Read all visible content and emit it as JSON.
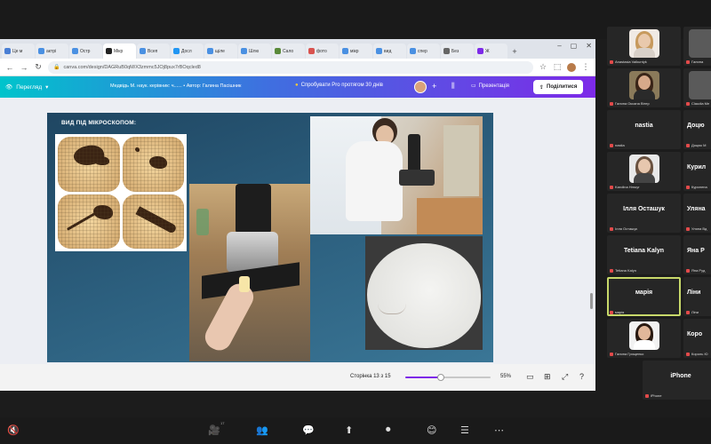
{
  "browser": {
    "tabs": [
      {
        "label": "Це м",
        "color": "#4a7fd4"
      },
      {
        "label": "актрі",
        "color": "#4a90e2"
      },
      {
        "label": "Остр",
        "color": "#4a90e2"
      },
      {
        "label": "Мікр",
        "color": "#222222"
      },
      {
        "label": "Всеп",
        "color": "#4a90e2"
      },
      {
        "label": "Досл",
        "color": "#2196f3"
      },
      {
        "label": "щіле",
        "color": "#4a90e2"
      },
      {
        "label": "Шлю",
        "color": "#4a90e2"
      },
      {
        "label": "Сало",
        "color": "#5a8a3a"
      },
      {
        "label": "фото",
        "color": "#d9534f"
      },
      {
        "label": "мікр",
        "color": "#4a90e2"
      },
      {
        "label": "вид",
        "color": "#4a90e2"
      },
      {
        "label": "спер",
        "color": "#4a90e2"
      },
      {
        "label": "Без",
        "color": "#666666"
      },
      {
        "label": "Ж",
        "color": "#7d2ae8"
      }
    ],
    "add_tab": "+",
    "url": "canva.com/design/DAGRuB0qM/X3zmmc5JOj8pux7rBOqcled8",
    "window_controls": [
      "–",
      "▢",
      "✕"
    ]
  },
  "canva": {
    "view_label": "Перегляд",
    "design_title": "Медвідь М. наук. керівник: ч...... • Автор: Галина Пасішник",
    "pro_label": "Спробувати Pro протягом 30 днів",
    "present_label": "Презентація",
    "share_label": "Поділитися",
    "slide": {
      "title": "ВИД ПІД МІКРОСКОПОМ:"
    },
    "page_indicator": "Сторінка 13 з 15",
    "zoom_value": "55%",
    "zoom_level": 0.42
  },
  "participants": {
    "col1": [
      {
        "name": "",
        "caption": "Anastasia Valkuntyk",
        "video": true,
        "skin": "#e9c9ac",
        "hair": "#c79a5d",
        "bg": "#f0eae4",
        "shirt": "#d8d0c8"
      },
      {
        "name": "",
        "caption": "Галина Оксана Вітер",
        "video": true,
        "skin": "#d7a98a",
        "hair": "#3a2518",
        "bg": "#8a7a5a",
        "shirt": "#2a2a2a"
      },
      {
        "name": "nastia",
        "caption": "nastia",
        "video": false
      },
      {
        "name": "",
        "caption": "Karolina Hmuyr",
        "video": true,
        "skin": "#e7c7ae",
        "hair": "#6a5240",
        "bg": "#e8e8e8",
        "shirt": "#444444"
      },
      {
        "name": "Ілля Осташук",
        "caption": "Ілля Осташук",
        "video": false
      },
      {
        "name": "Tetiana Kalyn",
        "caption": "Tetiana Kalyn",
        "video": false
      },
      {
        "name": "марія",
        "caption": "марія",
        "video": false,
        "highlight": true
      },
      {
        "name": "",
        "caption": "Галина Грищенко",
        "video": true,
        "skin": "#e1b79a",
        "hair": "#2a1a12",
        "bg": "#f2f2f2",
        "shirt": "#ffffff"
      }
    ],
    "col2": [
      {
        "name": "",
        "caption": "Галина",
        "video": true
      },
      {
        "name": "",
        "caption": "Claudia Me",
        "video": true
      },
      {
        "name": "Доцю",
        "caption": "Доцюк М",
        "video": false
      },
      {
        "name": "Курил",
        "caption": "Курилена",
        "video": false
      },
      {
        "name": "Уляна",
        "caption": "Уляна Вд",
        "video": false
      },
      {
        "name": "Яна Р",
        "caption": "Яна Руд",
        "video": false
      },
      {
        "name": "Ліни",
        "caption": "Ліни",
        "video": false
      },
      {
        "name": "Коро",
        "caption": "Король Ю",
        "video": false
      }
    ],
    "wide": {
      "name": "iPhone",
      "caption": "iPhone"
    }
  },
  "zoom_toolbar": {
    "buttons": [
      "🔇",
      "🎥",
      "👥",
      "💬",
      "⬆",
      "⏺",
      "😊",
      "☰",
      "⋯"
    ],
    "participants_count": "17"
  }
}
